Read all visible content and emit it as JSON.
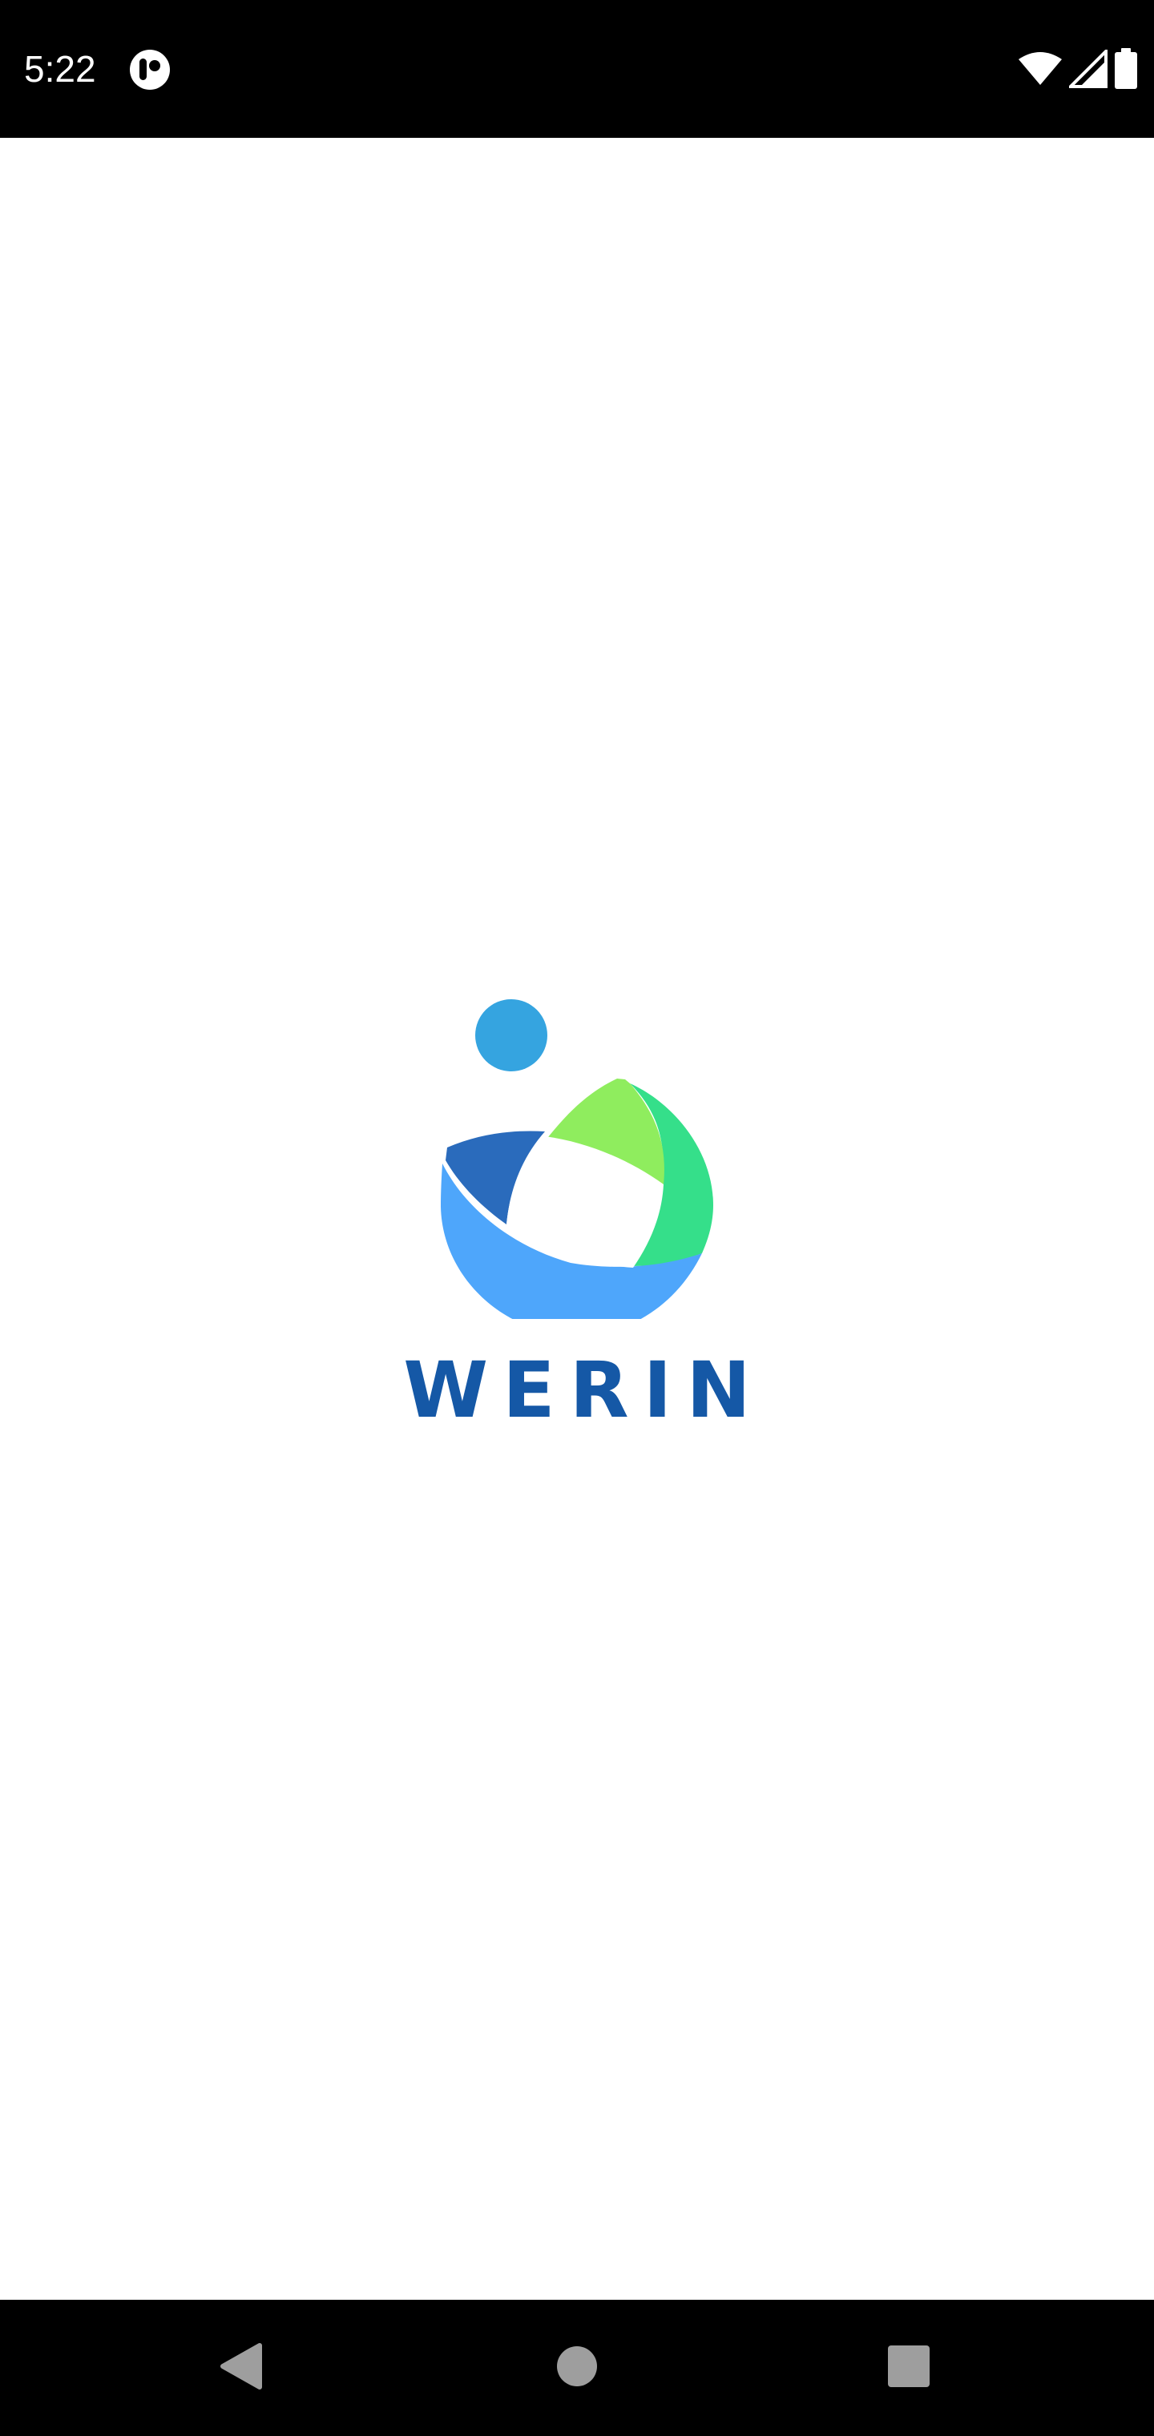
{
  "status_bar": {
    "time": "5:22",
    "app_icon": "notification-app-icon",
    "icons": [
      "wifi-icon",
      "cell-signal-icon",
      "battery-icon"
    ]
  },
  "splash": {
    "brand_name": "WERIN",
    "colors": {
      "brand_text": "#1558a6",
      "dot": "#35a4e0",
      "light_green": "#8fed5e",
      "teal_green": "#35df8a",
      "dark_blue": "#2a6bbc",
      "light_blue": "#4ea6fb"
    }
  },
  "nav_bar": {
    "back": "back-icon",
    "home": "home-icon",
    "recents": "recents-icon"
  }
}
